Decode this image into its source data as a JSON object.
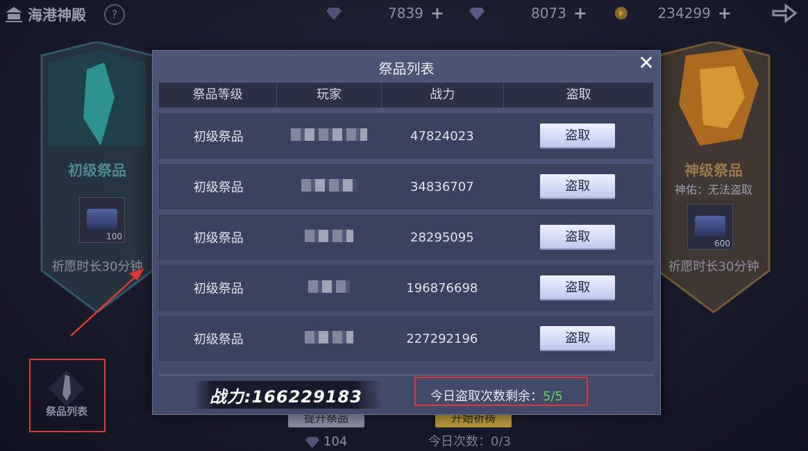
{
  "header": {
    "title": "海港神殿",
    "help": "?",
    "resources": [
      {
        "icon": "purple-diamond-icon",
        "value": "7839"
      },
      {
        "icon": "diamond-icon",
        "value": "8073"
      },
      {
        "icon": "gold-coin-icon",
        "value": "234299"
      }
    ]
  },
  "left_card": {
    "title": "初级祭品",
    "count": "100",
    "time": "祈愿时长30分钟"
  },
  "right_card": {
    "title": "神级祭品",
    "subtitle": "神佑：无法盗取",
    "count": "600",
    "time": "祈愿时长30分钟"
  },
  "bottom": {
    "left_button": "提升祭品",
    "right_button": "开始祈祷",
    "cost": "104",
    "today_count": "今日次数：0/3"
  },
  "list_button": {
    "label": "祭品列表"
  },
  "modal": {
    "title": "祭品列表",
    "close": "✕",
    "columns": [
      "祭品等级",
      "玩家",
      "战力",
      "盗取"
    ],
    "rows": [
      {
        "level": "初级祭品",
        "power": "47824023",
        "action": "盗取"
      },
      {
        "level": "初级祭品",
        "power": "34836707",
        "action": "盗取"
      },
      {
        "level": "初级祭品",
        "power": "28295095",
        "action": "盗取"
      },
      {
        "level": "初级祭品",
        "power": "196876698",
        "action": "盗取"
      },
      {
        "level": "初级祭品",
        "power": "227292196",
        "action": "盗取"
      }
    ],
    "my_power": "战力:166229183",
    "remaining_label": "今日盗取次数剩余：",
    "remaining_value": "5/5"
  },
  "colors": {
    "accent_green": "#69d65a",
    "annotation_red": "#e03a34",
    "gold": "#e0a23a"
  }
}
